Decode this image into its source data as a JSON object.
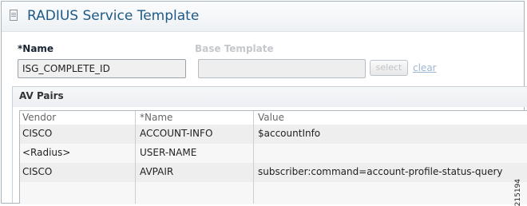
{
  "page": {
    "title": "RADIUS Service Template",
    "figure_number": "215194"
  },
  "form": {
    "name_label": "*Name",
    "name_value": "ISG_COMPLETE_ID",
    "base_template_label": "Base Template",
    "base_template_value": "",
    "select_button": "select",
    "clear_link": "clear"
  },
  "av_pairs": {
    "title": "AV Pairs",
    "columns": [
      "Vendor",
      "*Name",
      "Value"
    ],
    "rows": [
      {
        "vendor": "CISCO",
        "name": "ACCOUNT-INFO",
        "value": "$accountInfo"
      },
      {
        "vendor": "<Radius>",
        "name": "USER-NAME",
        "value": ""
      },
      {
        "vendor": "CISCO",
        "name": "AVPAIR",
        "value": "subscriber:command=account-profile-status-query"
      },
      {
        "vendor": "",
        "name": "",
        "value": ""
      }
    ]
  },
  "colors": {
    "title_text": "#1e5a86",
    "link_disabled": "#9db6d0"
  }
}
